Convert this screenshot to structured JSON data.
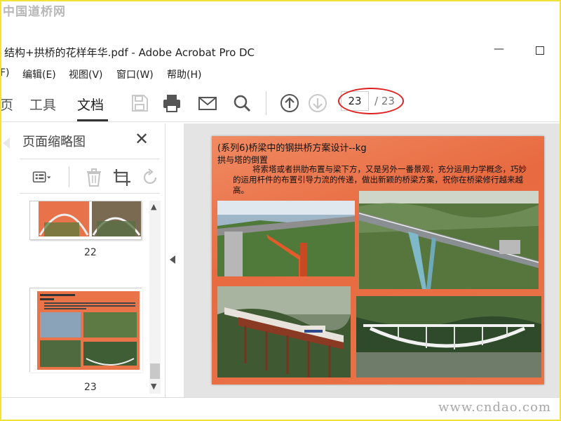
{
  "watermarks": {
    "top": "中国道桥网",
    "bottom": "www.cndao.com"
  },
  "window": {
    "title": "结构+拱桥的花样年华.pdf - Adobe Acrobat Pro DC",
    "minimize": "—"
  },
  "menu": {
    "items": [
      "F)",
      "编辑(E)",
      "视图(V)",
      "窗口(W)",
      "帮助(H)"
    ]
  },
  "toolbar": {
    "tabs": [
      "页",
      "工具",
      "文档"
    ],
    "active_tab": "文档",
    "icons": [
      "save-icon",
      "print-icon",
      "mail-icon",
      "search-icon",
      "page-up-icon",
      "page-down-icon"
    ],
    "page_current": "23",
    "page_total": "/ 23",
    "highlight_color": "#e02020"
  },
  "sidebar": {
    "title": "页面缩略图",
    "close": "✕",
    "tools": [
      "thumbnail-options-icon",
      "delete-page-icon",
      "crop-page-icon",
      "rotate-icon"
    ],
    "thumbnails": [
      {
        "label": "22"
      },
      {
        "label": "23"
      }
    ]
  },
  "document": {
    "heading": "(系列6)桥梁中的钢拱桥方案设计--kg",
    "subheading": "拱与塔的倒置",
    "body": "将索塔或者拱肋布置与梁下方，又是另外一番景观；充分运用力学概念，巧妙的运用杆件的布置引导力流的传递，做出新颖的桥梁方案，祝你在桥梁修行越来越高。",
    "accent_color": "#ea7448"
  }
}
